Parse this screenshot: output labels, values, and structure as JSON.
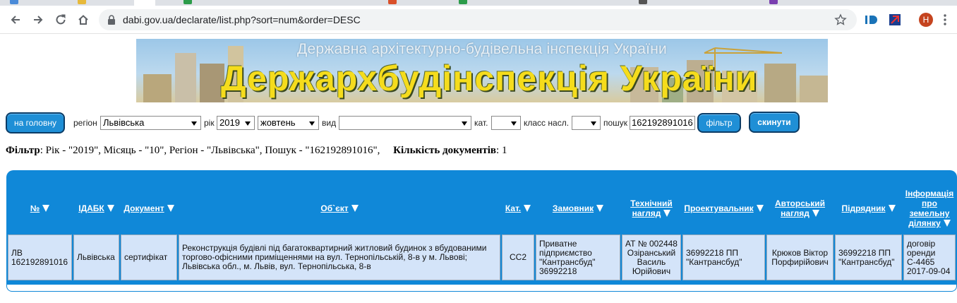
{
  "browser": {
    "url": "dabi.gov.ua/declarate/list.php?sort=num&order=DESC",
    "profile_initial": "Н"
  },
  "banner": {
    "subtitle": "Державна архітектурно-будівельна інспекція України",
    "title": "Держархбудінспекція України"
  },
  "filters": {
    "home_button": "на головну",
    "region_label": "регіон",
    "region_value": "Львівська",
    "year_label": "рік",
    "year_value": "2019",
    "month_value": "жовтень",
    "type_label": "вид",
    "type_value": "",
    "category_label": "кат.",
    "category_value": "",
    "class_label": "класс насл.",
    "class_value": "",
    "search_label": "пошук",
    "search_value": "162192891016",
    "filter_button": "фільтр",
    "reset_button": "скинути"
  },
  "summary": {
    "filter_label": "Фільтр",
    "filter_text": ": Рік - \"2019\", Місяць - \"10\", Регіон - \"Львівська\", Пошук - \"162192891016\",",
    "count_label": "Кількість документів",
    "count_value": ": 1"
  },
  "table": {
    "headers": [
      [
        "№"
      ],
      [
        "ІДАБК"
      ],
      [
        "Документ"
      ],
      [
        "Об`єкт"
      ],
      [
        "Кат."
      ],
      [
        "Замовник"
      ],
      [
        "Технічний",
        "нагляд"
      ],
      [
        "Проектувальник"
      ],
      [
        "Авторський",
        "нагляд"
      ],
      [
        "Підрядник"
      ],
      [
        "Інформація",
        "про",
        "земельну",
        "ділянку"
      ]
    ],
    "rows": [
      {
        "num": "ЛВ 162192891016",
        "idabk": "Львівська",
        "doc": "сертифікат",
        "object": "Реконструкція будівлі під багатоквартирний житловий будинок з вбудованими торгово-офісними приміщеннями на вул. Тернопільській, 8-в у м. Львові; Львівська обл., м. Львів, вул. Тернопільська, 8-в",
        "cat": "СС2",
        "customer": "Приватне підприємство \"Кантрансбуд\" 36992218",
        "tech": "АТ № 002448 Озіранський Василь Юрійович",
        "designer": "36992218 ПП \"Кантрансбуд\"",
        "author": "Крюков Віктор Порфирійович",
        "contractor": "36992218 ПП \"Кантрансбуд\"",
        "land": "договір оренди С-4465 2017-09-04"
      }
    ]
  },
  "colors": {
    "table_header": "#1088d8",
    "row_bg": "#d4e4f9",
    "button_blue": "#1f8fd6"
  }
}
